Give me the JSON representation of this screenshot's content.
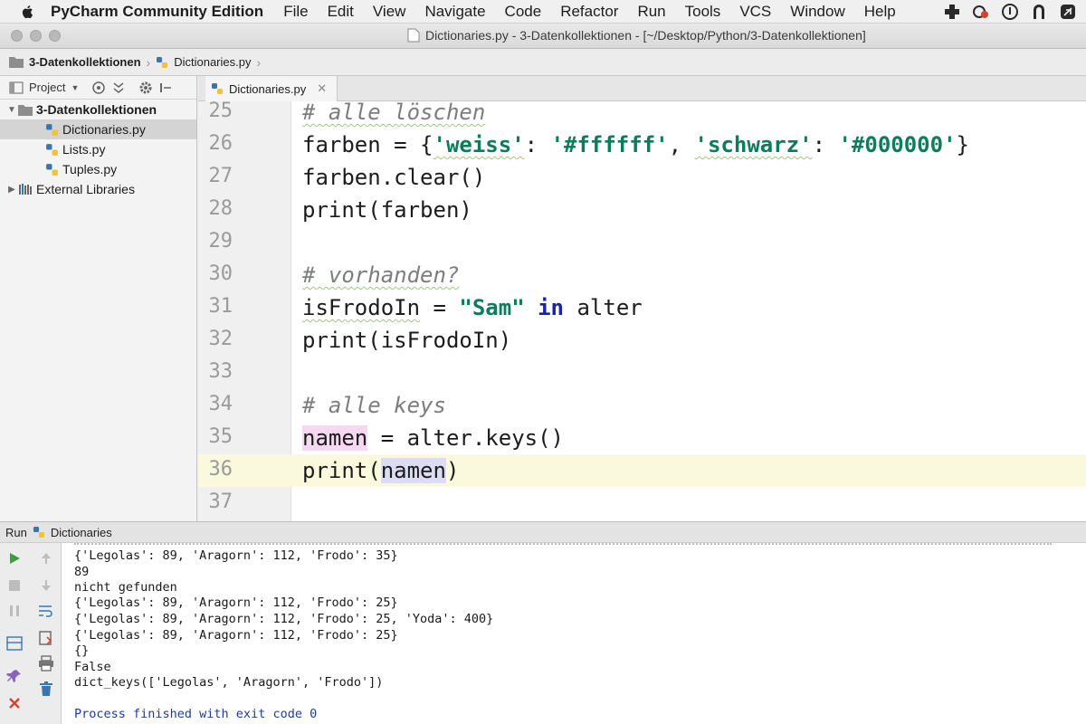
{
  "menubar": {
    "app_name": "PyCharm Community Edition",
    "items": [
      "File",
      "Edit",
      "View",
      "Navigate",
      "Code",
      "Refactor",
      "Run",
      "Tools",
      "VCS",
      "Window",
      "Help"
    ]
  },
  "window": {
    "title": "Dictionaries.py - 3-Datenkollektionen - [~/Desktop/Python/3-Datenkollektionen]"
  },
  "breadcrumb": {
    "folder": "3-Datenkollektionen",
    "file": "Dictionaries.py"
  },
  "sidebar": {
    "view_label": "Project",
    "tree": [
      {
        "label": "3-Datenkollektionen",
        "type": "folder",
        "level": 0,
        "expanded": true
      },
      {
        "label": "Dictionaries.py",
        "type": "python",
        "level": 1,
        "selected": true
      },
      {
        "label": "Lists.py",
        "type": "python",
        "level": 1
      },
      {
        "label": "Tuples.py",
        "type": "python",
        "level": 1
      },
      {
        "label": "External Libraries",
        "type": "library",
        "level": 0,
        "expanded": false
      }
    ]
  },
  "editor": {
    "tab_label": "Dictionaries.py",
    "line_numbers": [
      "25",
      "26",
      "27",
      "28",
      "29",
      "30",
      "31",
      "32",
      "33",
      "34",
      "35",
      "36",
      "37"
    ],
    "current_line": "36",
    "code": {
      "l25_comment": "# alle löschen",
      "l26_var": "farben",
      "l26_eq": " = {",
      "l26_k1": "'weiss'",
      "l26_colon1": ": ",
      "l26_v1": "'#ffffff'",
      "l26_comma": ", ",
      "l26_k2": "'schwarz'",
      "l26_colon2": ": ",
      "l26_v2": "'#000000'",
      "l26_close": "}",
      "l27": "farben.clear()",
      "l28": "print(farben)",
      "l30_comment": "# vorhanden?",
      "l31_var": "isFrodoIn",
      "l31_eq": " = ",
      "l31_str": "\"Sam\"",
      "l31_kw": " in",
      "l31_rest": " alter",
      "l32": "print(isFrodoIn)",
      "l34_comment": "# alle keys",
      "l35_var": "namen",
      "l35_rest": " = alter.keys()",
      "l36_pre": "print(",
      "l36_arg": "namen",
      "l36_post": ")"
    }
  },
  "run_panel": {
    "label": "Run",
    "config": "Dictionaries",
    "output": [
      "{'Legolas': 89, 'Aragorn': 112, 'Frodo': 35}",
      "89",
      "nicht gefunden",
      "{'Legolas': 89, 'Aragorn': 112, 'Frodo': 25}",
      "{'Legolas': 89, 'Aragorn': 112, 'Frodo': 25, 'Yoda': 400}",
      "{'Legolas': 89, 'Aragorn': 112, 'Frodo': 25}",
      "{}",
      "False",
      "dict_keys(['Legolas', 'Aragorn', 'Frodo'])",
      "",
      "Process finished with exit code 0"
    ]
  },
  "colors": {
    "string": "#0a7d5b",
    "keyword": "#1a23a7",
    "comment": "#7d7d7d",
    "current_line": "#fbf9dd",
    "run_green": "#3f9b3f",
    "stop_red": "#d9402e"
  }
}
